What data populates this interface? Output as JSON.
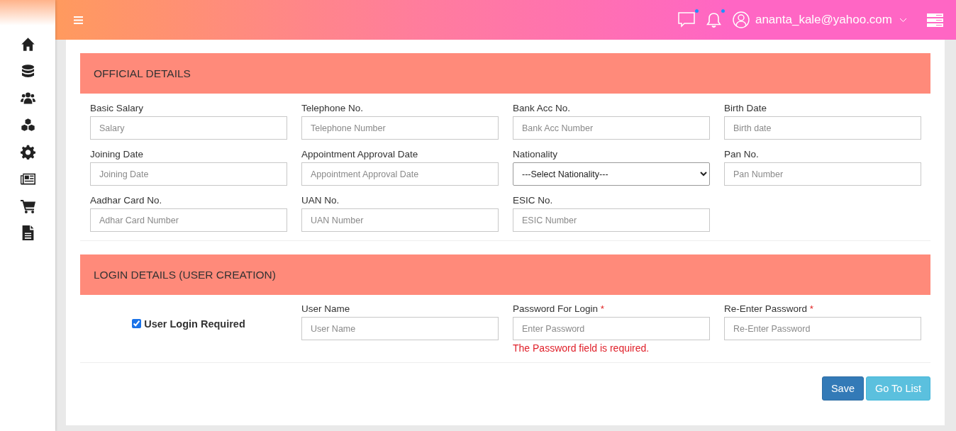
{
  "sidebar": {
    "items": [
      {
        "kind": "home"
      },
      {
        "kind": "database"
      },
      {
        "kind": "users"
      },
      {
        "kind": "cubes"
      },
      {
        "kind": "settings"
      },
      {
        "kind": "newspaper"
      },
      {
        "kind": "cart"
      },
      {
        "kind": "file"
      }
    ]
  },
  "header": {
    "messages": {
      "unread": true
    },
    "notifications": {
      "unread": true
    },
    "user_email": "ananta_kale@yahoo.com"
  },
  "official_details": {
    "title": "OFFICIAL DETAILS",
    "fields": [
      {
        "kind": "text",
        "label": "Basic Salary",
        "placeholder": "Salary"
      },
      {
        "kind": "text",
        "label": "Telephone No.",
        "placeholder": "Telephone Number"
      },
      {
        "kind": "text",
        "label": "Bank Acc No.",
        "placeholder": "Bank Acc Number"
      },
      {
        "kind": "text",
        "label": "Birth Date",
        "placeholder": "Birth date"
      },
      {
        "kind": "text",
        "label": "Joining Date",
        "placeholder": "Joining Date"
      },
      {
        "kind": "text",
        "label": "Appointment Approval Date",
        "placeholder": "Appointment Approval Date"
      },
      {
        "kind": "select",
        "label": "Nationality",
        "value": "---Select Nationality---"
      },
      {
        "kind": "text",
        "label": "Pan No.",
        "placeholder": "Pan Number"
      },
      {
        "kind": "text",
        "label": "Aadhar Card No.",
        "placeholder": "Adhar Card Number"
      },
      {
        "kind": "text",
        "label": "UAN No.",
        "placeholder": "UAN Number"
      },
      {
        "kind": "text",
        "label": "ESIC No.",
        "placeholder": "ESIC Number"
      }
    ]
  },
  "login_details": {
    "title": "LOGIN DETAILS (USER CREATION)",
    "login_required": {
      "label": "User Login Required",
      "checked": true
    },
    "fields": [
      {
        "kind": "text",
        "label": "User Name",
        "placeholder": "User Name"
      },
      {
        "kind": "text",
        "label": "Password For Login",
        "placeholder": "Enter Password",
        "required_mark": "*",
        "error": "The Password field is required."
      },
      {
        "kind": "text",
        "label": "Re-Enter Password",
        "placeholder": "Re-Enter Password",
        "required_mark": "*"
      }
    ]
  },
  "buttons": [
    {
      "kind": "primary",
      "label": "Save"
    },
    {
      "kind": "info",
      "label": "Go To List"
    }
  ]
}
